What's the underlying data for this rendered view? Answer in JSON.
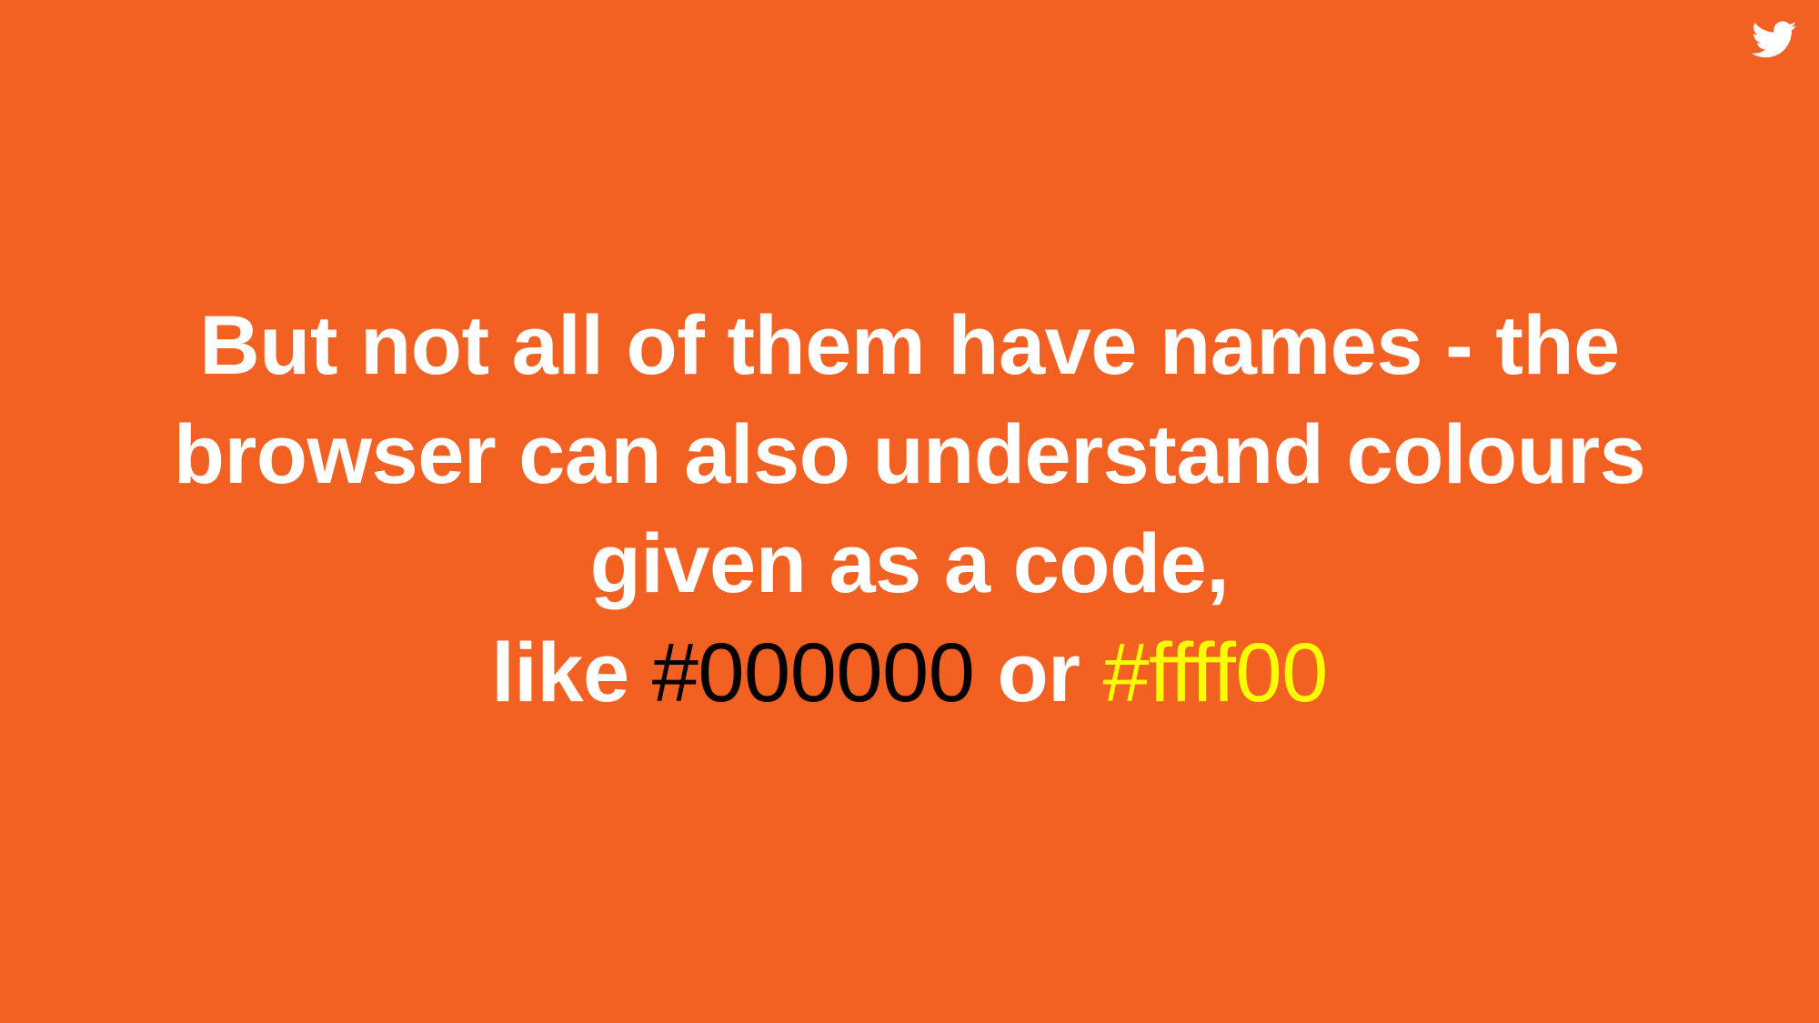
{
  "slide": {
    "background_color": "#f26022",
    "text_color": "#ffffff",
    "lines": [
      "But not all of them have names - the",
      "browser can also understand colours",
      "given as a code,"
    ],
    "last_line": {
      "prefix": "like ",
      "code_1": "#000000",
      "code_1_color": "#000000",
      "middle": " or ",
      "code_2": "#ffff00",
      "code_2_color": "#ffff00"
    },
    "icon": "twitter-icon"
  }
}
